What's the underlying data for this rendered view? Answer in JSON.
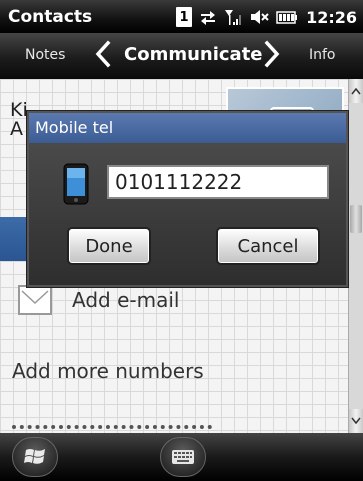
{
  "status_bar": {
    "app_title": "Contacts",
    "sim_indicator": "1",
    "time": "12:26"
  },
  "nav": {
    "left_item": "Notes",
    "current": "Communicate",
    "right_item": "Info"
  },
  "content": {
    "name_fragment": "Ki\nA",
    "add_email": "Add e-mail",
    "add_more_numbers": "Add more numbers"
  },
  "dialog": {
    "title": "Mobile tel",
    "value": "0101112222",
    "done_label": "Done",
    "cancel_label": "Cancel"
  },
  "colors": {
    "dialog_titlebar": "#4a6aa2",
    "accent_band": "#2f5c99",
    "background_grid": "#f4f4f4"
  }
}
